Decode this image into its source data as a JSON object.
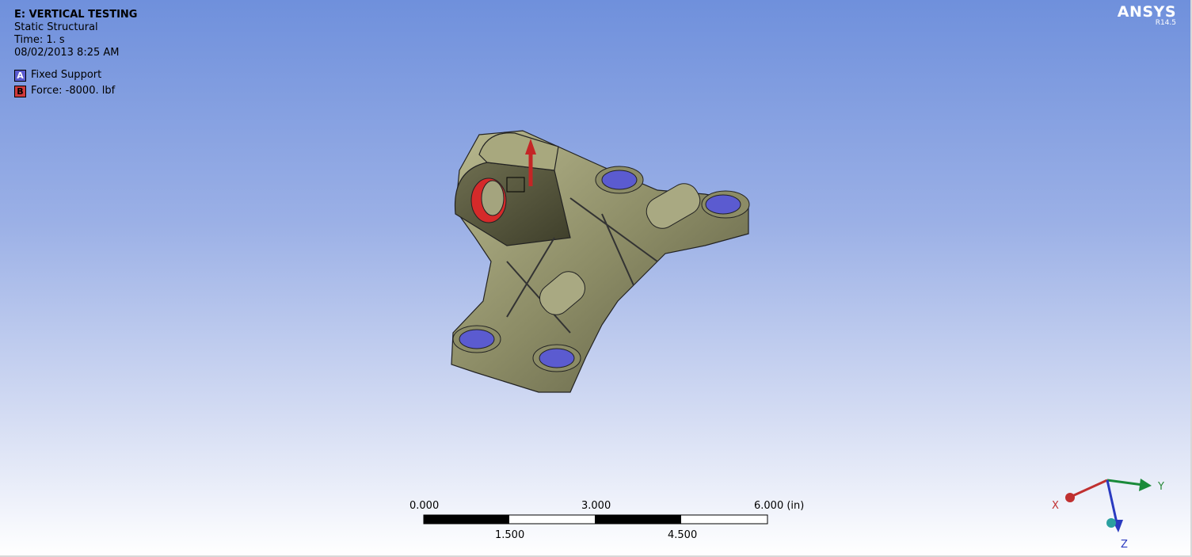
{
  "viewport": {
    "title": "E: VERTICAL TESTING",
    "analysis_type": "Static Structural",
    "time": "Time: 1. s",
    "timestamp": "08/02/2013 8:25 AM"
  },
  "legend": [
    {
      "key": "A",
      "label": "Fixed Support",
      "color": "#4d4dc8"
    },
    {
      "key": "B",
      "label": "Force: -8000. lbf",
      "color": "#d03a3a"
    }
  ],
  "logo": {
    "name": "ANSYS",
    "version": "R14.5"
  },
  "scale_bar": {
    "top_labels": [
      "0.000",
      "3.000",
      "6.000 (in)"
    ],
    "bottom_labels": [
      "1.500",
      "4.500"
    ]
  },
  "triad": {
    "x_label": "X",
    "y_label": "Y",
    "z_label": "Z"
  },
  "colors": {
    "model": "#8a8a64",
    "fixed_support": "#5b5bd0",
    "force": "#cc2a2a"
  }
}
